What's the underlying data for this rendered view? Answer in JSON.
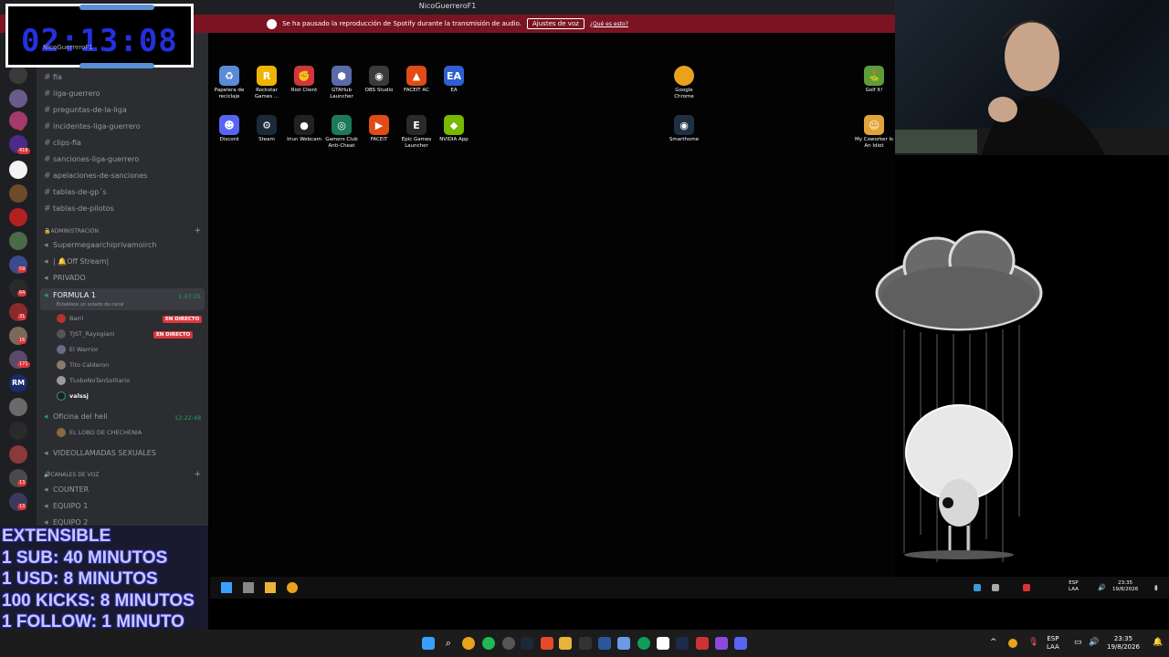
{
  "discord": {
    "window_title": "NicoGuerreroF1",
    "banner": {
      "message": "Se ha pausado la reproducción de Spotify durante la transmisión de audio.",
      "button": "Ajustes de voz",
      "link": "¿Qué es esto?"
    },
    "text_channels": [
      "fia",
      "liga-guerrero",
      "preguntas-de-la-liga",
      "incidentes-liga-guerrero",
      "clips-fia",
      "sanciones-liga-guerrero",
      "apelaciones-de-sanciones",
      "tablas-de-gp´s",
      "tablas-de-pilotos"
    ],
    "admin_category": "🔒ADMINISTRACIÓN",
    "admin_channels": [
      "Supermegaarchiprivamoirch",
      "| 🔔Off Stream|",
      "PRIVADO"
    ],
    "voice_formula": {
      "name": "FORMULA 1",
      "status_hint": "Establece un estado de canal",
      "time": "1:07:25",
      "users": [
        "Barri",
        "TJST_Rayogiani",
        "El Warrior",
        "Tito Calderon",
        "TLoboNoTanSolitario",
        "valssj"
      ],
      "live_label": "EN DIRECTO"
    },
    "voice_oficina": {
      "name": "Oficina del heli",
      "time": "12:22:48",
      "users": [
        "EL LOBO DE CHECHENIA"
      ]
    },
    "voice_extra": "VIDEOLLAMADAS SEXUALES",
    "voice_category": "🔊CANALES DE VOZ",
    "voice_channels": [
      "COUNTER",
      "EQUIPO 1",
      "EQUIPO 2"
    ],
    "server_badges": [
      "3",
      "418",
      "59",
      "64",
      "31",
      "16",
      "171",
      "13",
      "13"
    ]
  },
  "overlay": {
    "timer": "02:13:08",
    "timer_user": "NicoGuerreroF1",
    "extensible_lines": [
      "EXTENSIBLE",
      "1 SUB: 40 MINUTOS",
      "1 USD: 8 MINUTOS",
      "100 KICKS: 8 MINUTOS",
      "1 FOLLOW: 1 MINUTO"
    ]
  },
  "desktop": {
    "icons_row1": [
      {
        "label": "Papelera de reciclaje",
        "glyph": "♻",
        "color": "#5a8bd6"
      },
      {
        "label": "Rockstar Games ...",
        "glyph": "R",
        "color": "#f0b400"
      },
      {
        "label": "Riot Client",
        "glyph": "✊",
        "color": "#d13639"
      },
      {
        "label": "GTAHub Launcher",
        "glyph": "⬢",
        "color": "#5b6aa8"
      },
      {
        "label": "OBS Studio",
        "glyph": "◉",
        "color": "#3a3a3a"
      },
      {
        "label": "FACEIT AC",
        "glyph": "▲",
        "color": "#e04b16"
      },
      {
        "label": "EA",
        "glyph": "EA",
        "color": "#2f5fd1"
      }
    ],
    "icons_row2": [
      {
        "label": "Discord",
        "glyph": "☻",
        "color": "#5865f2"
      },
      {
        "label": "Steam",
        "glyph": "⚙",
        "color": "#1b2838"
      },
      {
        "label": "Iriun Webcam",
        "glyph": "●",
        "color": "#222"
      },
      {
        "label": "Gamers Club Anti-Cheat",
        "glyph": "◎",
        "color": "#1b7a5a"
      },
      {
        "label": "FACEIT",
        "glyph": "▶",
        "color": "#e04b16"
      },
      {
        "label": "Epic Games Launcher",
        "glyph": "E",
        "color": "#2a2a2a"
      },
      {
        "label": "NVIDIA App",
        "glyph": "◆",
        "color": "#76b900"
      }
    ],
    "chrome_icon": {
      "label": "Google Chrome",
      "glyph": "◍",
      "color": "#e8a21c"
    },
    "smarthome_icon": {
      "label": "Smarthome",
      "glyph": "◉",
      "color": "#1e2f44"
    },
    "golf_icon": {
      "label": "Golf It!",
      "glyph": "⛳",
      "color": "#5d9c3a"
    },
    "coworker_icon": {
      "label": "My Coworker Is An Idiot",
      "glyph": "☺",
      "color": "#e2a43a"
    }
  },
  "inner_taskbar": {
    "lang": "ESP",
    "lang2": "LAA",
    "time": "23:35",
    "date": "19/8/2026"
  },
  "outer_taskbar": {
    "lang": "ESP",
    "lang2": "LAA",
    "time": "23:35",
    "date": "19/8/2026"
  }
}
